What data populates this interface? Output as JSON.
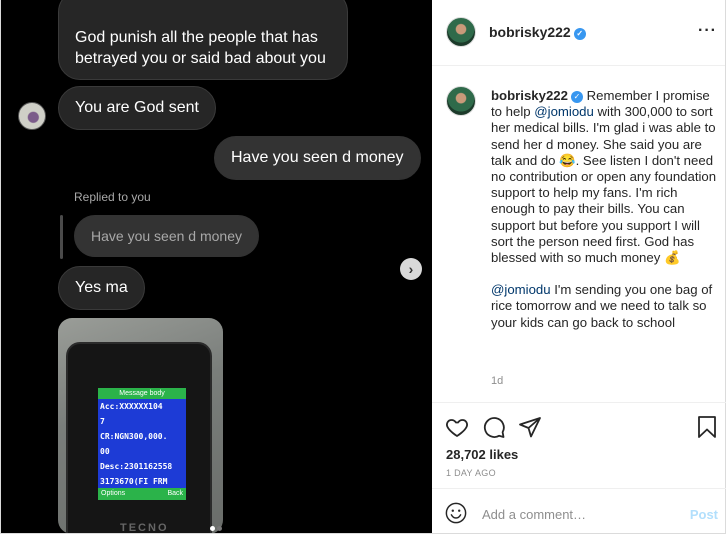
{
  "media": {
    "messages": {
      "top_bubble": "God punish all the people that has betrayed you or said bad about you",
      "god_sent": "You are God sent",
      "money_question": "Have you seen d money",
      "replied_label": "Replied to you",
      "quoted": "Have you seen d money",
      "yes_ma": "Yes ma"
    },
    "phone_screen": {
      "header": "Message body",
      "lines": [
        "Acc:XXXXXX104",
        "7",
        "CR:NGN300,000.",
        "00",
        "Desc:2301162558",
        "3173670(FI FRM"
      ],
      "left_softkey": "Options",
      "right_softkey": "Back",
      "brand": "TECNO"
    },
    "next_icon": "chevron-right-icon"
  },
  "post": {
    "username": "bobrisky222",
    "caption": {
      "part1": "Remember I promise to help ",
      "mention1": "@jomiodu",
      "part2": " with 300,000 to sort her medical bills. I'm glad i was able to send her d money. She said you are talk and do 😂. See listen I don't need no contribution or open any foundation support to help my fans. I'm rich enough to pay their bills. You can support but before you support I will sort the person need first. God has blessed with so much money 💰",
      "mention2": "@jomiodu",
      "part3": " I'm sending you one bag of rice tomorrow and we need to talk so your kids can go back to school"
    },
    "caption_age": "1d",
    "likes": "28,702 likes",
    "posted": "1 DAY AGO",
    "comment_placeholder": "Add a comment…",
    "post_label": "Post",
    "colors": {
      "verified": "#3897f0",
      "mention": "#00376b",
      "post_disabled": "#b2dffc"
    }
  }
}
